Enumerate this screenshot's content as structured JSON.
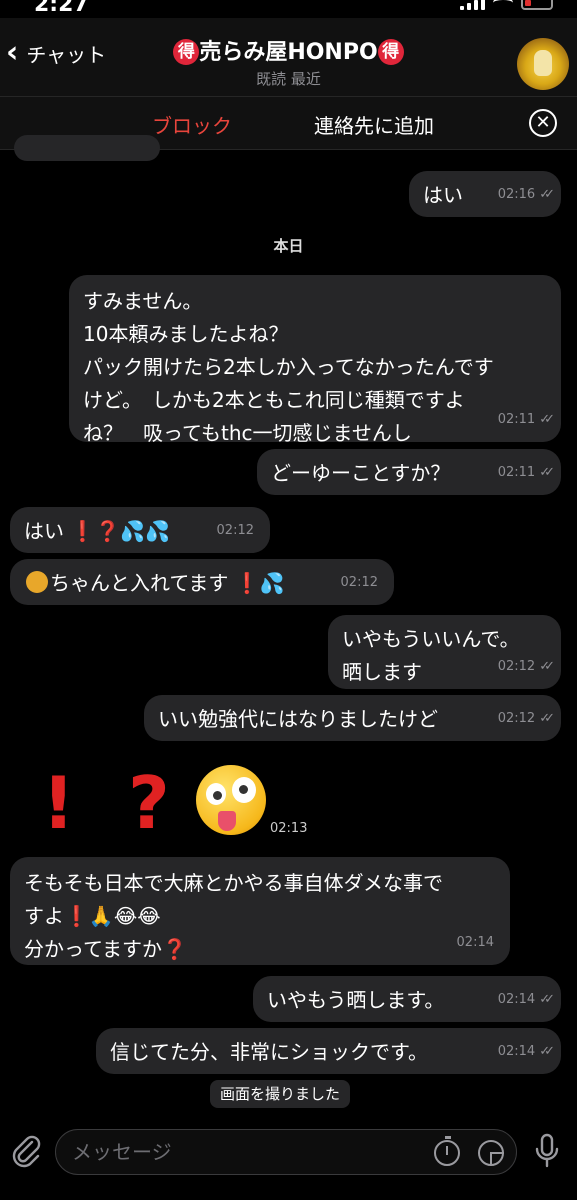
{
  "status": {
    "time": "2:27",
    "battery_color": "#e03030"
  },
  "header": {
    "back_label": "チャット",
    "title_badge": "得",
    "title_text": "売らみ屋HONPO",
    "subtitle": "既読 最近",
    "avatar_icon": "avatar-icon"
  },
  "actions": {
    "block_label": "ブロック",
    "add_contact_label": "連絡先に追加",
    "close_icon": "close-icon",
    "accent_red": "#e8453c"
  },
  "chat": {
    "date_separator": "本日",
    "messages": [
      {
        "from": "me",
        "text": "はい",
        "time": "02:16",
        "read": true
      },
      {
        "from": "me",
        "lines": [
          "すみません。",
          "10本頼みましたよね？",
          "パック開けたら2本しか入ってなかったんです",
          "けど。　しかも2本ともこれ同じ種類ですよ",
          "ね？　吸ってもthc一切感じませんし"
        ],
        "time": "02:11",
        "read": true
      },
      {
        "from": "me",
        "text": "どーゆーことすか？",
        "time": "02:11",
        "read": true
      },
      {
        "from": "them",
        "text": "はい",
        "emoji": [
          "exclamation",
          "question",
          "sweat-drops",
          "sweat-drops"
        ],
        "time": "02:12"
      },
      {
        "from": "them",
        "text": "ちゃんと入れてます",
        "emoji_lead": "honey-pot",
        "emoji": [
          "exclamation",
          "sweat-drops"
        ],
        "time": "02:12"
      },
      {
        "from": "me",
        "lines": [
          "いやもういいんで。",
          "晒します"
        ],
        "time": "02:12",
        "read": true
      },
      {
        "from": "me",
        "text": "いい勉強代にはなりましたけど",
        "time": "02:12",
        "read": true
      },
      {
        "from": "them",
        "big_emoji": [
          "exclamation",
          "question",
          "zany-face"
        ],
        "time": "02:13"
      },
      {
        "from": "them",
        "lines": [
          "そもそも日本で大麻とかやる事自体ダメな事で",
          "すよ",
          "分かってますか"
        ],
        "time": "02:14"
      },
      {
        "from": "me",
        "text": "いやもう晒します。",
        "time": "02:14",
        "read": true
      },
      {
        "from": "me",
        "text": "信じてた分、非常にショックです。",
        "time": "02:14",
        "read": true
      }
    ],
    "screenshot_notice": "画面を撮りました"
  },
  "input": {
    "placeholder": "メッセージ",
    "attach_icon": "paperclip-icon",
    "timer_icon": "timer-icon",
    "sticker_icon": "sticker-icon",
    "mic_icon": "microphone-icon"
  },
  "colors": {
    "bubble": "#262628",
    "background": "#000000",
    "emoji_red": "#e33030",
    "drop_blue": "#5ab3f0"
  }
}
